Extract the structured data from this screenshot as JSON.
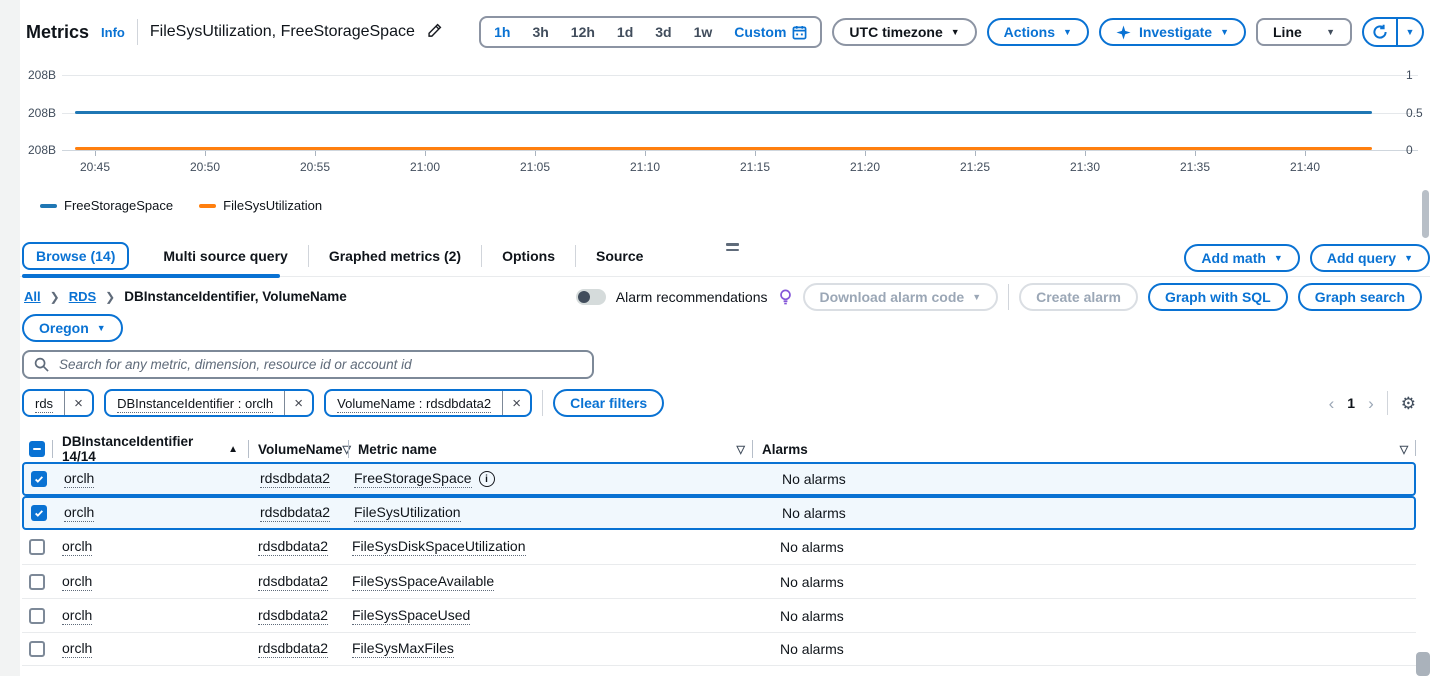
{
  "colors": {
    "accent": "#0972d3",
    "text": "#0f141a",
    "muted": "#5f6b7a",
    "series_blue": "#1f77b4",
    "series_orange": "#ff7f0e",
    "selected_row_bg": "#f1f8fd"
  },
  "header": {
    "title": "Metrics",
    "info_label": "Info",
    "graph_title": "FileSysUtilization, FreeStorageSpace",
    "time_ranges": [
      "1h",
      "3h",
      "12h",
      "1d",
      "3d",
      "1w"
    ],
    "selected_range": "1h",
    "custom_label": "Custom",
    "timezone_label": "UTC timezone",
    "actions_label": "Actions",
    "investigate_label": "Investigate",
    "graph_type_label": "Line"
  },
  "chart_data": {
    "type": "line",
    "x": [
      "20:45",
      "20:50",
      "20:55",
      "21:00",
      "21:05",
      "21:10",
      "21:15",
      "21:20",
      "21:25",
      "21:30",
      "21:35",
      "21:40"
    ],
    "left_axis_ticks": [
      "208B",
      "208B",
      "208B"
    ],
    "right_axis_ticks": [
      "1",
      "0.5",
      "0"
    ],
    "series": [
      {
        "name": "FreeStorageSpace",
        "color": "#1f77b4",
        "axis": "left",
        "constant_value": "208B",
        "level": "middle"
      },
      {
        "name": "FileSysUtilization",
        "color": "#ff7f0e",
        "axis": "right",
        "constant_value": "0",
        "level": "bottom"
      }
    ],
    "grid": true,
    "legend_position": "bottom-left"
  },
  "panel": {
    "tabs": [
      {
        "label": "Browse (14)",
        "selected": true
      },
      {
        "label": "Multi source query",
        "selected": false
      },
      {
        "label": "Graphed metrics (2)",
        "selected": false
      },
      {
        "label": "Options",
        "selected": false
      },
      {
        "label": "Source",
        "selected": false
      }
    ],
    "add_math_label": "Add math",
    "add_query_label": "Add query"
  },
  "browse": {
    "breadcrumb": [
      {
        "label": "All",
        "link": true
      },
      {
        "label": "RDS",
        "link": true
      },
      {
        "label": "DBInstanceIdentifier, VolumeName",
        "link": false
      }
    ],
    "alarm_recommendations_label": "Alarm recommendations",
    "alarm_toggle_on": false,
    "download_alarm_code_label": "Download alarm code",
    "create_alarm_label": "Create alarm",
    "graph_with_sql_label": "Graph with SQL",
    "graph_search_label": "Graph search",
    "region_label": "Oregon",
    "search_placeholder": "Search for any metric, dimension, resource id or account id",
    "filters": [
      "rds",
      "DBInstanceIdentifier : orclh",
      "VolumeName : rdsdbdata2"
    ],
    "clear_filters_label": "Clear filters",
    "pagination": {
      "prev": "‹",
      "page": "1",
      "next": "›"
    },
    "table": {
      "select_all_state": "indeterminate",
      "columns": [
        {
          "label": "DBInstanceIdentifier 14/14",
          "sort": "ascending"
        },
        {
          "label": "VolumeName",
          "sort": "none"
        },
        {
          "label": "Metric name",
          "sort": "none"
        },
        {
          "label": "Alarms",
          "sort": "none"
        }
      ],
      "rows": [
        {
          "checked": true,
          "instance": "orclh",
          "volume": "rdsdbdata2",
          "metric": "FreeStorageSpace",
          "metric_info_icon": true,
          "alarms": "No alarms"
        },
        {
          "checked": true,
          "instance": "orclh",
          "volume": "rdsdbdata2",
          "metric": "FileSysUtilization",
          "metric_info_icon": false,
          "alarms": "No alarms"
        },
        {
          "checked": false,
          "instance": "orclh",
          "volume": "rdsdbdata2",
          "metric": "FileSysDiskSpaceUtilization",
          "metric_info_icon": false,
          "alarms": "No alarms"
        },
        {
          "checked": false,
          "instance": "orclh",
          "volume": "rdsdbdata2",
          "metric": "FileSysSpaceAvailable",
          "metric_info_icon": false,
          "alarms": "No alarms"
        },
        {
          "checked": false,
          "instance": "orclh",
          "volume": "rdsdbdata2",
          "metric": "FileSysSpaceUsed",
          "metric_info_icon": false,
          "alarms": "No alarms"
        },
        {
          "checked": false,
          "instance": "orclh",
          "volume": "rdsdbdata2",
          "metric": "FileSysMaxFiles",
          "metric_info_icon": false,
          "alarms": "No alarms"
        }
      ]
    }
  },
  "icons": {
    "edit": "pencil-icon",
    "custom_range": "calendar-icon",
    "investigate": "sparkle-icon",
    "refresh": "refresh-icon",
    "dropdown": "caret-down-icon",
    "alarm_hint": "lightbulb-icon",
    "search": "search-icon",
    "remove_filter": "close-icon",
    "settings": "gear-icon",
    "metric_info": "info-circle-icon",
    "sort_ascending": "triangle-up-icon",
    "sortable": "triangle-down-outline-icon"
  }
}
